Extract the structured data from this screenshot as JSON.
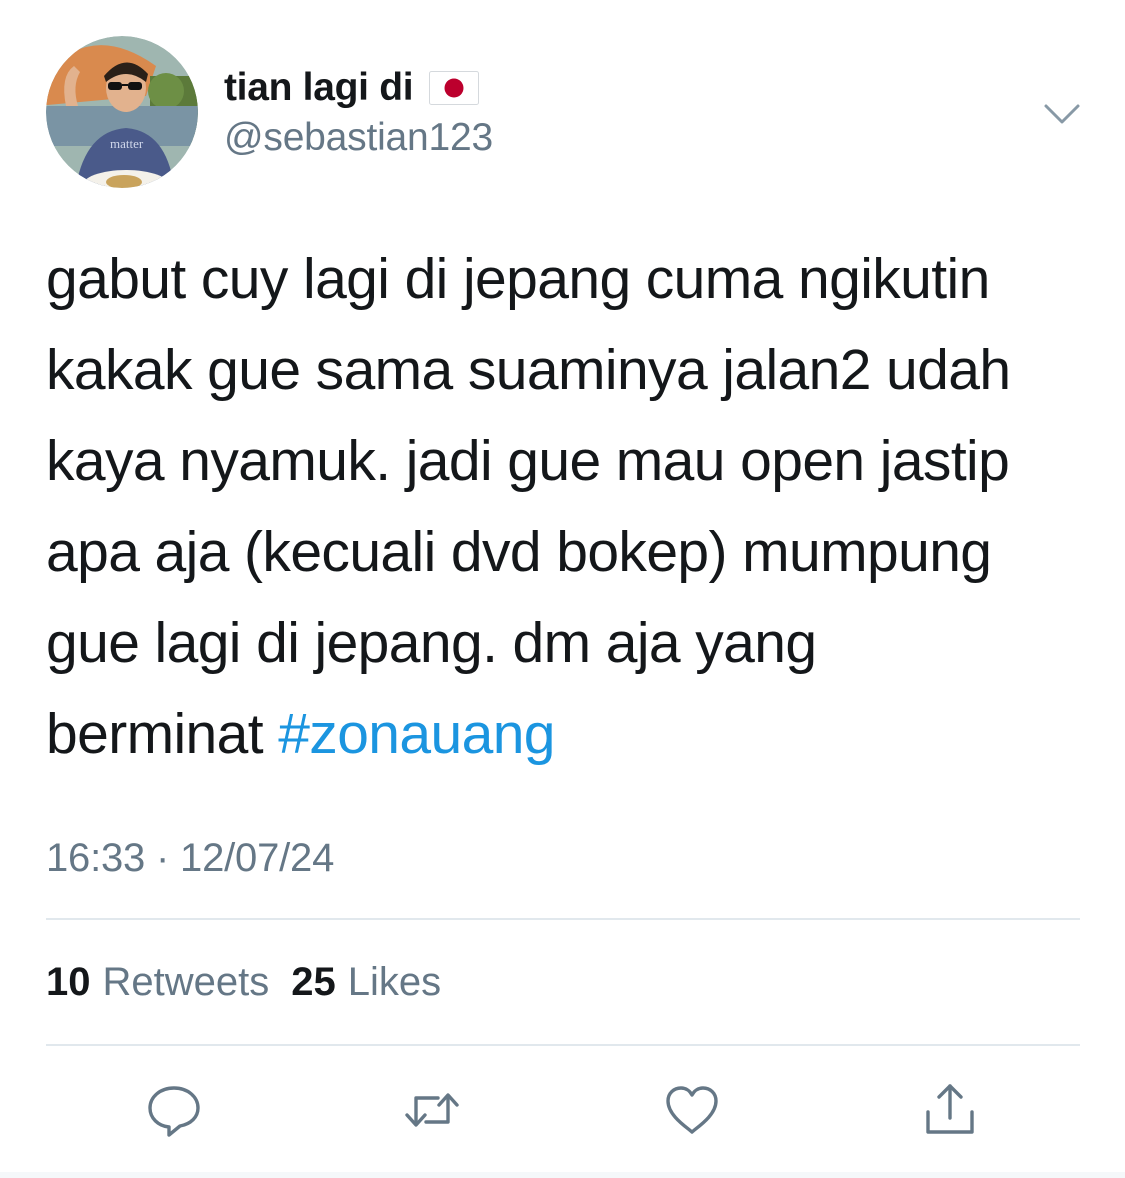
{
  "user": {
    "display_name": "tian lagi di",
    "flag": "🇯🇵",
    "handle": "@sebastian123",
    "avatar_shirt_text": "matter"
  },
  "tweet": {
    "lines": [
      "gabut cuy lagi di jepang cuma ngikutin",
      "kakak gue sama suaminya jalan2 udah",
      "kaya nyamuk. jadi gue mau open jastip",
      "apa aja (kecuali dvd bokep) mumpung",
      "gue lagi di jepang. dm aja yang",
      "berminat "
    ],
    "hashtag": "#zonauang",
    "timestamp": "16:33 · 12/07/24"
  },
  "stats": {
    "retweets_count": "10",
    "retweets_label": "Retweets",
    "likes_count": "25",
    "likes_label": "Likes"
  },
  "icons": {
    "more": "chevron-down-icon",
    "reply": "reply-bubble-icon",
    "retweet": "retweet-icon",
    "like": "heart-icon",
    "share": "share-icon"
  },
  "colors": {
    "text": "#14171a",
    "secondary": "#657786",
    "link": "#1b95e0",
    "divider": "#e1e8ed",
    "icon": "#657786"
  }
}
